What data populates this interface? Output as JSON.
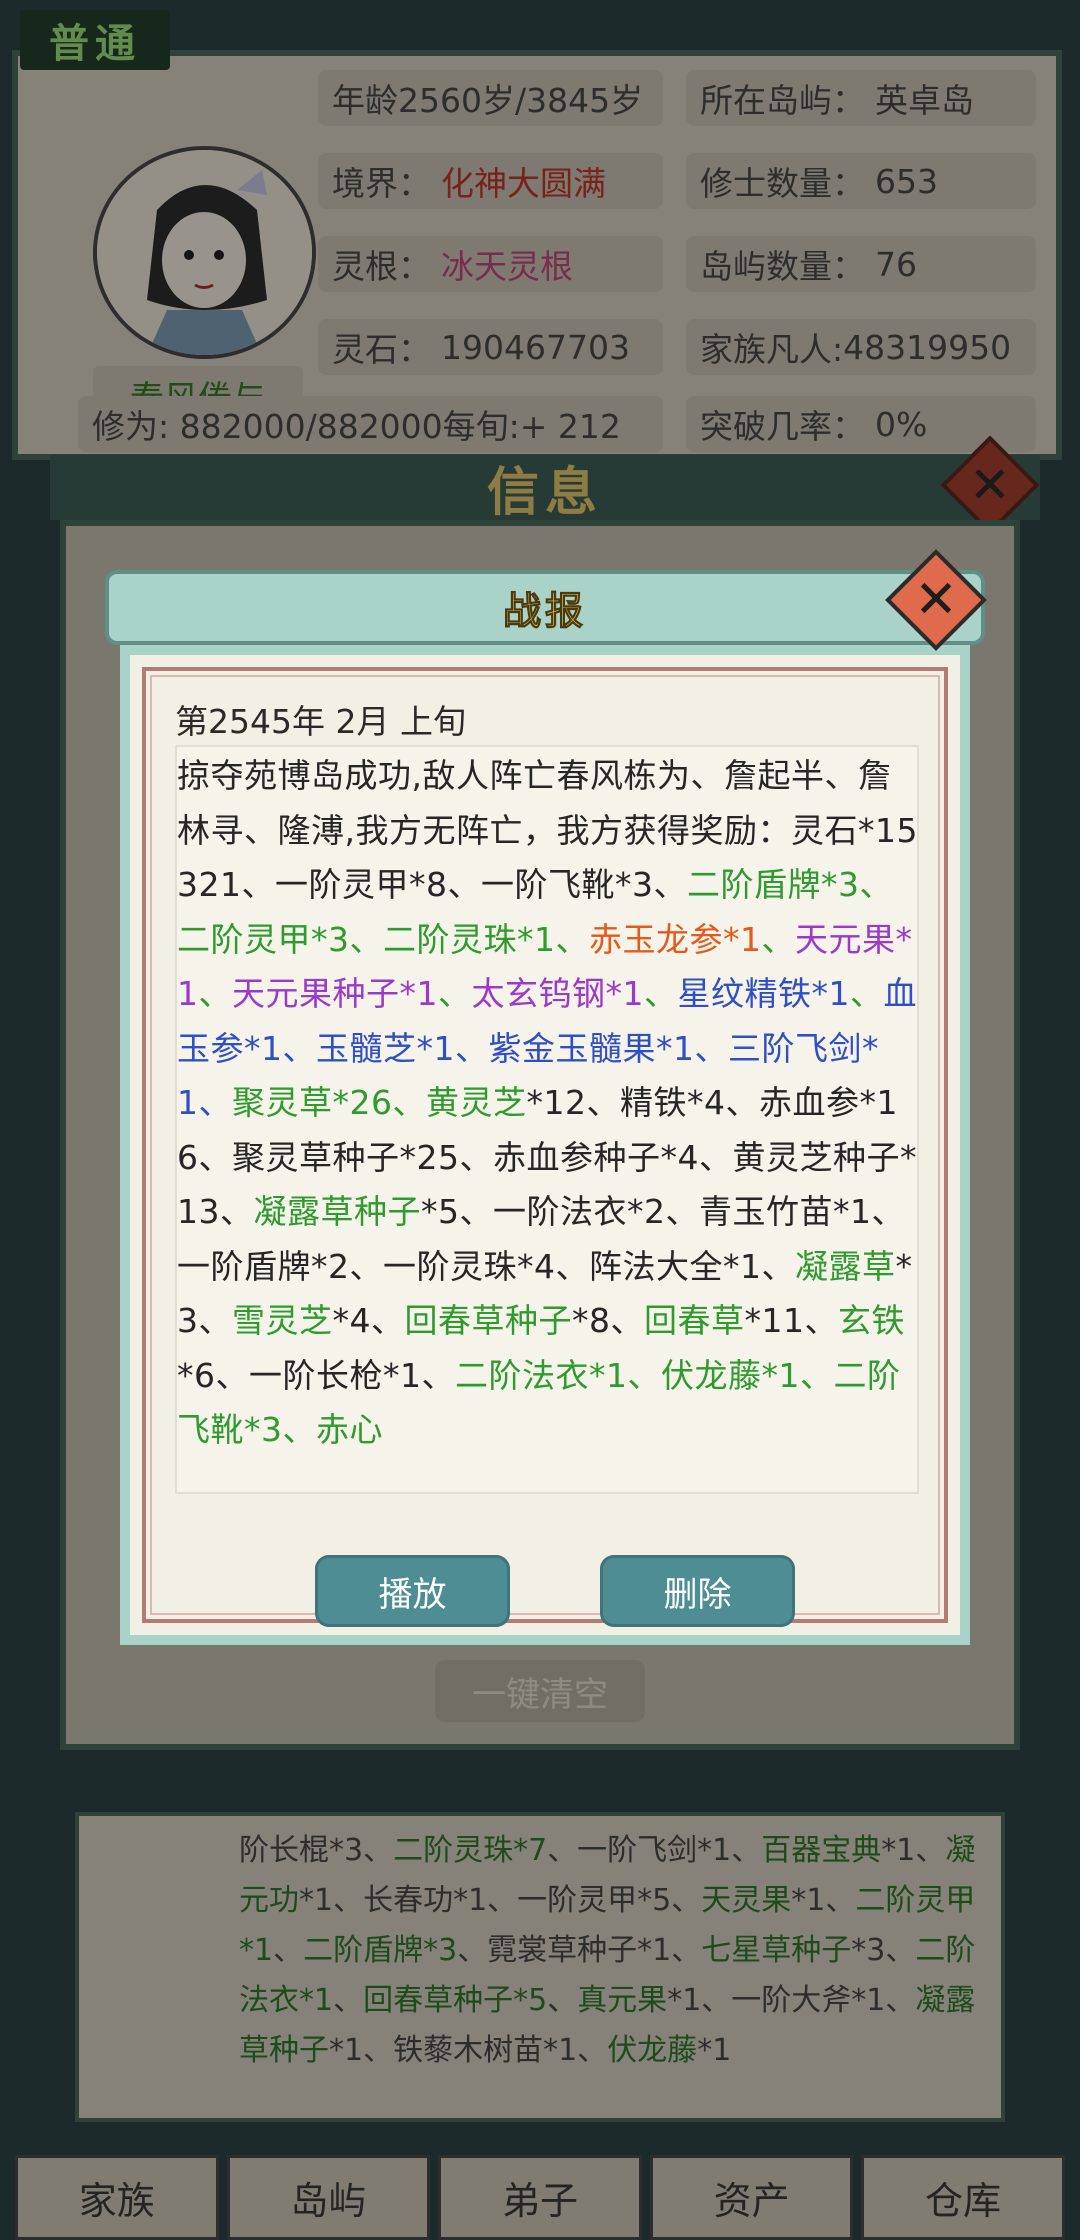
{
  "mode_badge": "普通",
  "profile": {
    "name": "春风倦与",
    "age": "年龄2560岁/3845岁",
    "island_label": "所在岛屿：",
    "island_value": "英卓岛",
    "realm_label": "境界：",
    "realm_value": "化神大圆满",
    "cultivators_label": "修士数量：",
    "cultivators_value": "653",
    "root_label": "灵根：",
    "root_value": "冰天灵根",
    "islands_label": "岛屿数量：",
    "islands_value": "76",
    "stones_label": "灵石：",
    "stones_value": "190467703",
    "mortals_label": "家族凡人:",
    "mortals_value": "48319950",
    "cultivation": "修为: 882000/882000每旬:+ 212",
    "breakthrough_label": "突破几率：",
    "breakthrough_value": "0%"
  },
  "info_title": "信息",
  "clear_all": "一键清空",
  "bottom_log": [
    {
      "t": "阶长棍*3、",
      "c": "k"
    },
    {
      "t": "二阶灵珠*7",
      "c": "g"
    },
    {
      "t": "、一阶飞剑*1、",
      "c": "k"
    },
    {
      "t": "百器宝典",
      "c": "g"
    },
    {
      "t": "*1、",
      "c": "k"
    },
    {
      "t": "凝元功",
      "c": "g"
    },
    {
      "t": "*1、长春功*1、一阶灵甲*5、",
      "c": "k"
    },
    {
      "t": "天灵果",
      "c": "g"
    },
    {
      "t": "*1、",
      "c": "k"
    },
    {
      "t": "二阶灵甲*1",
      "c": "g"
    },
    {
      "t": "、",
      "c": "k"
    },
    {
      "t": "二阶盾牌*3",
      "c": "g"
    },
    {
      "t": "、霓裳草种子*1、",
      "c": "k"
    },
    {
      "t": "七",
      "c": "g"
    },
    {
      "t": "星草种子",
      "c": "g"
    },
    {
      "t": "*3、",
      "c": "k"
    },
    {
      "t": "二阶法衣*1",
      "c": "g"
    },
    {
      "t": "、",
      "c": "k"
    },
    {
      "t": "回春草种子*5",
      "c": "g"
    },
    {
      "t": "、",
      "c": "k"
    },
    {
      "t": "真元果",
      "c": "g"
    },
    {
      "t": "*1、一阶大斧*1、",
      "c": "k"
    },
    {
      "t": "凝露草种子",
      "c": "g"
    },
    {
      "t": "*1、铁藜木树苗*1、",
      "c": "k"
    },
    {
      "t": "伏龙藤",
      "c": "g"
    },
    {
      "t": "*1",
      "c": "k"
    }
  ],
  "tabs": [
    "家族",
    "岛屿",
    "弟子",
    "资产",
    "仓库"
  ],
  "modal": {
    "title": "战报",
    "date": "第2545年 2月 上旬",
    "play_label": "播放",
    "delete_label": "删除",
    "segments": [
      {
        "t": "掠夺苑博岛成功,敌人阵亡春风栋为、詹起半、詹林寻、隆溥,我方无阵亡，我方获得奖励：灵石*15321、一阶灵甲*8、一阶飞靴*3、",
        "c": "k"
      },
      {
        "t": "二阶盾牌*3",
        "c": "g"
      },
      {
        "t": "、",
        "c": "g"
      },
      {
        "t": "二阶灵甲*3",
        "c": "g"
      },
      {
        "t": "、",
        "c": "g"
      },
      {
        "t": "二阶灵珠*1",
        "c": "g"
      },
      {
        "t": "、",
        "c": "g"
      },
      {
        "t": "赤玉龙参*1",
        "c": "o"
      },
      {
        "t": "、",
        "c": "g"
      },
      {
        "t": "天元果*1",
        "c": "p"
      },
      {
        "t": "、",
        "c": "g"
      },
      {
        "t": "天元果种子*1",
        "c": "p"
      },
      {
        "t": "、",
        "c": "g"
      },
      {
        "t": "太玄钨钢*1",
        "c": "p"
      },
      {
        "t": "、",
        "c": "g"
      },
      {
        "t": "星纹精铁*1",
        "c": "b"
      },
      {
        "t": "、",
        "c": "g"
      },
      {
        "t": "血玉参*1",
        "c": "b"
      },
      {
        "t": "、",
        "c": "b"
      },
      {
        "t": "玉髓芝*1",
        "c": "b"
      },
      {
        "t": "、",
        "c": "b"
      },
      {
        "t": "紫金玉髓果*1",
        "c": "b"
      },
      {
        "t": "、",
        "c": "b"
      },
      {
        "t": "三阶飞剑*1",
        "c": "b"
      },
      {
        "t": "、",
        "c": "b"
      },
      {
        "t": "聚灵草*26",
        "c": "g"
      },
      {
        "t": "、",
        "c": "g"
      },
      {
        "t": "黄灵芝",
        "c": "g"
      },
      {
        "t": "*12、精铁*4、赤血参*16、聚灵草种子*25、赤血参种子*4、黄灵芝种子*13、",
        "c": "k"
      },
      {
        "t": "凝露草种子",
        "c": "g"
      },
      {
        "t": "*5、一阶法衣*2、青玉竹苗*1、一阶盾牌*2、一阶灵珠*4、阵法大全*1、",
        "c": "k"
      },
      {
        "t": "凝露草",
        "c": "g"
      },
      {
        "t": "*3、",
        "c": "k"
      },
      {
        "t": "雪灵芝",
        "c": "g"
      },
      {
        "t": "*4、",
        "c": "k"
      },
      {
        "t": "回春草种子",
        "c": "g"
      },
      {
        "t": "*8、",
        "c": "k"
      },
      {
        "t": "回春草",
        "c": "g"
      },
      {
        "t": "*11、",
        "c": "k"
      },
      {
        "t": "玄铁",
        "c": "g"
      },
      {
        "t": "*6、一阶长枪*1、",
        "c": "k"
      },
      {
        "t": "二阶法衣*1",
        "c": "g"
      },
      {
        "t": "、",
        "c": "g"
      },
      {
        "t": "伏龙藤*1",
        "c": "g"
      },
      {
        "t": "、",
        "c": "g"
      },
      {
        "t": "二阶飞靴*3",
        "c": "g"
      },
      {
        "t": "、",
        "c": "g"
      },
      {
        "t": "赤心",
        "c": "g"
      }
    ]
  }
}
